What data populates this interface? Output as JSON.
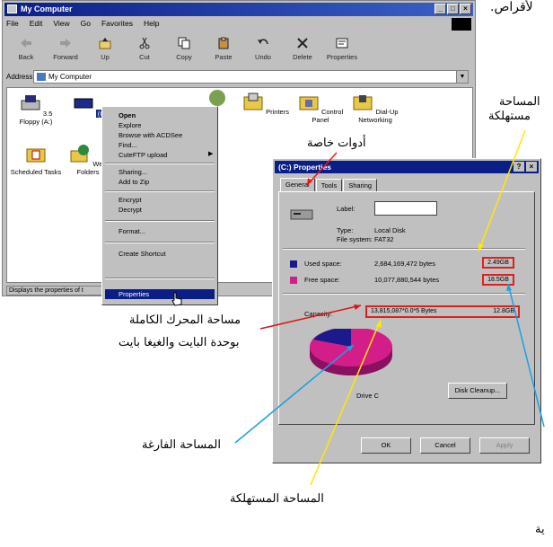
{
  "window": {
    "title": "My Computer",
    "menu": [
      "File",
      "Edit",
      "View",
      "Go",
      "Favorites",
      "Help"
    ],
    "toolbar": [
      {
        "label": "Back",
        "icon": "back-arrow-icon",
        "disabled": true
      },
      {
        "label": "Forward",
        "icon": "forward-arrow-icon",
        "disabled": true
      },
      {
        "label": "Up",
        "icon": "up-folder-icon",
        "disabled": false
      },
      {
        "label": "Cut",
        "icon": "scissors-icon",
        "disabled": false
      },
      {
        "label": "Copy",
        "icon": "copy-icon",
        "disabled": false
      },
      {
        "label": "Paste",
        "icon": "clipboard-icon",
        "disabled": false
      },
      {
        "label": "Undo",
        "icon": "undo-icon",
        "disabled": false
      },
      {
        "label": "Delete",
        "icon": "delete-x-icon",
        "disabled": false
      },
      {
        "label": "Properties",
        "icon": "properties-icon",
        "disabled": false
      }
    ],
    "address_label": "Address",
    "address_value": "My Computer",
    "items": [
      {
        "label": "3.5 Floppy (A:)",
        "icon": "floppy-drive-icon"
      },
      {
        "label": "(C:)",
        "icon": "hard-drive-icon"
      },
      {
        "label": "Printers",
        "icon": "printers-folder-icon"
      },
      {
        "label": "Control Panel",
        "icon": "control-panel-folder-icon"
      },
      {
        "label": "Dial-Up Networking",
        "icon": "dialup-networking-icon"
      },
      {
        "label": "Scheduled Tasks",
        "icon": "scheduled-tasks-icon"
      },
      {
        "label": "Web Folders",
        "icon": "web-folders-icon"
      }
    ],
    "status": "Displays the properties of t"
  },
  "context_menu": {
    "items": [
      "Open",
      "Explore",
      "Browse with ACDSee",
      "Find...",
      "CuteFTP upload",
      "Sharing...",
      "Add to Zip",
      "Encrypt",
      "Decrypt",
      "Format...",
      "Create Shortcut",
      "Properties"
    ],
    "selected": "Properties"
  },
  "dialog": {
    "title": "(C:) Properties",
    "tabs": [
      "General",
      "Tools",
      "Sharing"
    ],
    "label_caption": "Label:",
    "type_caption": "Type:",
    "type_value": "Local Disk",
    "fs_caption": "File system:",
    "fs_value": "FAT32",
    "used_caption": "Used space:",
    "used_bytes": "2,684,169,472 bytes",
    "used_gb": "2.49GB",
    "free_caption": "Free space:",
    "free_bytes": "10,077,880,544 bytes",
    "free_gb": "18.5GB",
    "capacity_caption": "Capacity:",
    "capacity_bytes": "13,815,087*0.0*5 Bytes",
    "capacity_gb": "12.8GB",
    "drive_caption": "Drive C",
    "disk_cleanup": "Disk Cleanup...",
    "ok": "OK",
    "cancel": "Cancel",
    "apply": "Apply",
    "colors": {
      "used": "#1a1a8c",
      "free": "#d31e8a"
    }
  },
  "annotations": {
    "top_cut": "لأقراص.",
    "used_top": "المساحة",
    "used_top2": "مستهلكة",
    "special_tools": "أدوات خاصة",
    "full_capacity1": "مساحة المحرك الكاملة",
    "full_capacity2": "بوحدة البايت والغيغا بايت",
    "free_space": "المساحة الفارغة",
    "used_space": "المساحة المستهلكة",
    "bottom_cut": "ية"
  }
}
